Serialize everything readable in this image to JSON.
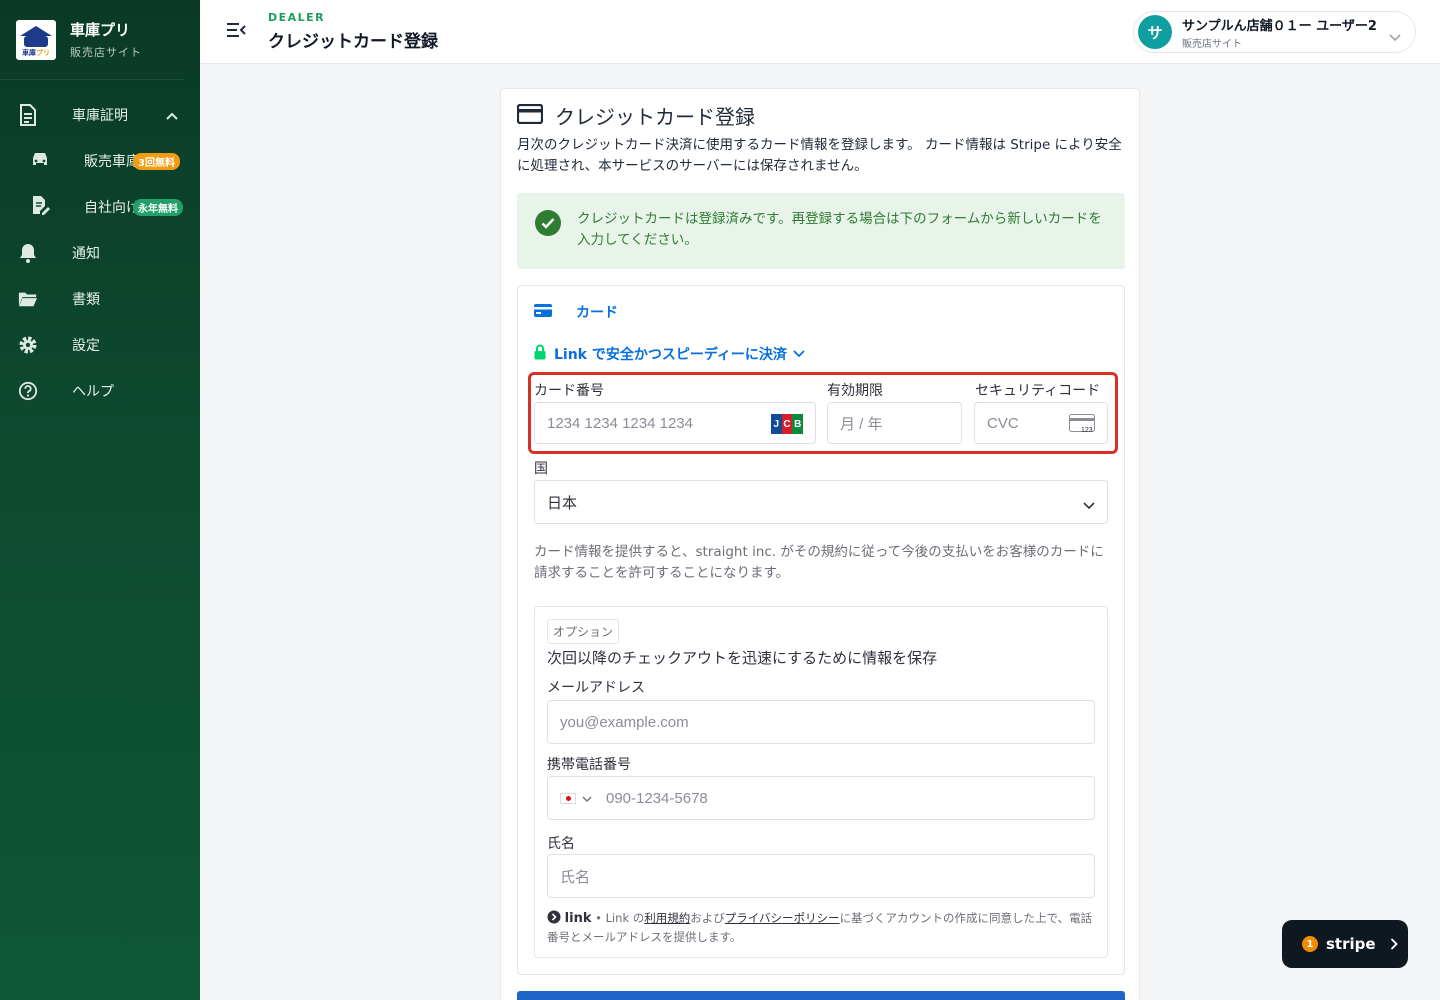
{
  "brand": {
    "name": "車庫プリ",
    "sub": "販売店サイト",
    "logo_text_a": "車庫",
    "logo_text_b": "プリ"
  },
  "sidebar": {
    "items": [
      {
        "label": "車庫証明",
        "icon": "document-icon",
        "expanded": true
      },
      {
        "label": "販売車庫",
        "icon": "car-icon",
        "badge": "3回無料",
        "badge_color": "#f39c12"
      },
      {
        "label": "自社向け",
        "icon": "edit-document-icon",
        "badge": "永年無料",
        "badge_color": "#22a06b"
      },
      {
        "label": "通知",
        "icon": "bell-icon"
      },
      {
        "label": "書類",
        "icon": "folder-icon"
      },
      {
        "label": "設定",
        "icon": "gear-icon"
      },
      {
        "label": "ヘルプ",
        "icon": "help-icon"
      }
    ]
  },
  "header": {
    "kicker": "DEALER",
    "title": "クレジットカード登録",
    "user": {
      "avatar": "サ",
      "name": "サンプルん店舗０１ー ユーザー2",
      "role": "販売店サイト"
    }
  },
  "card": {
    "title": "クレジットカード登録",
    "description": "月次のクレジットカード決済に使用するカード情報を登録します。 カード情報は Stripe により安全に処理され、本サービスのサーバーには保存されません。",
    "alert": "クレジットカードは登録済みです。再登録する場合は下のフォームから新しいカードを入力してください。"
  },
  "stripe": {
    "tab": "カード",
    "link_prompt": "Link で安全かつスピーディーに決済",
    "card_number_label": "カード番号",
    "card_number_placeholder": "1234 1234 1234 1234",
    "expiry_label": "有効期限",
    "expiry_placeholder": "月 / 年",
    "cvc_label": "セキュリティコード",
    "cvc_placeholder": "CVC",
    "cvc_icon_text": "123",
    "country_label": "国",
    "country_value": "日本",
    "terms": "カード情報を提供すると、straight inc. がその規約に従って今後の支払いをお客様のカードに請求することを許可することになります。",
    "option": {
      "tag": "オプション",
      "heading": "次回以降のチェックアウトを迅速にするために情報を保存",
      "email_label": "メールアドレス",
      "email_placeholder": "you@example.com",
      "phone_label": "携帯電話番号",
      "phone_placeholder": "090-1234-5678",
      "name_label": "氏名",
      "name_placeholder": "氏名",
      "legal_logo": "link",
      "legal_1": " • Link の",
      "legal_terms": "利用規約",
      "legal_2": "および",
      "legal_privacy": "プライバシーポリシー",
      "legal_3": "に基づくアカウントの作成に同意した上で、電話番号とメールアドレスを提供します。"
    }
  },
  "stripe_badge": {
    "count": "1",
    "word": "stripe"
  },
  "colors": {
    "sidebar": "#0d4a30",
    "accent_green": "#1f9d5c",
    "stripe_blue": "#0570de",
    "highlight_red": "#d93025",
    "alert_bg": "#e8f3ea"
  }
}
